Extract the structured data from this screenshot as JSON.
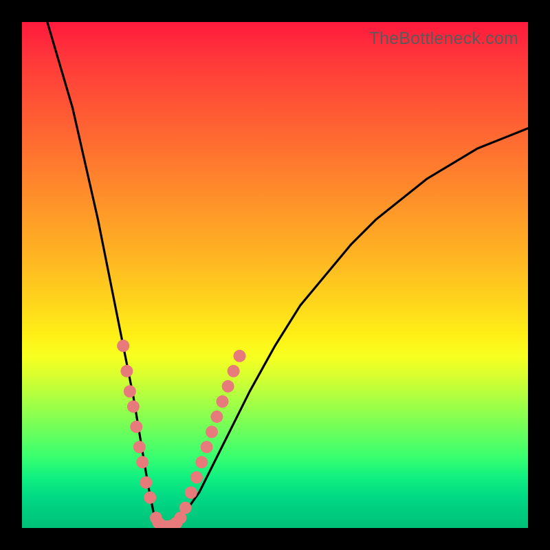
{
  "watermark": "TheBottleneck.com",
  "chart_data": {
    "type": "line",
    "title": "",
    "xlabel": "",
    "ylabel": "",
    "xlim": [
      0,
      100
    ],
    "ylim": [
      0,
      100
    ],
    "series": [
      {
        "name": "valley-curve",
        "x": [
          5,
          10,
          15,
          18,
          20,
          22,
          24,
          25,
          26,
          27,
          28,
          30,
          35,
          40,
          45,
          50,
          55,
          60,
          65,
          70,
          75,
          80,
          85,
          90,
          95,
          100
        ],
        "values": [
          100,
          83,
          61,
          46,
          36,
          26,
          14,
          8,
          3,
          1,
          0,
          0,
          7,
          17,
          27,
          36,
          44,
          50,
          56,
          61,
          65,
          69,
          72,
          75,
          77,
          79
        ]
      }
    ],
    "dot_markers": {
      "name": "highlighted-points",
      "color": "#e77a7a",
      "points": [
        {
          "x": 20.0,
          "y": 36
        },
        {
          "x": 20.7,
          "y": 31
        },
        {
          "x": 21.3,
          "y": 27
        },
        {
          "x": 22.0,
          "y": 24
        },
        {
          "x": 22.6,
          "y": 20
        },
        {
          "x": 23.2,
          "y": 16
        },
        {
          "x": 23.8,
          "y": 13
        },
        {
          "x": 24.5,
          "y": 9
        },
        {
          "x": 25.3,
          "y": 6
        },
        {
          "x": 26.5,
          "y": 2
        },
        {
          "x": 27.0,
          "y": 1
        },
        {
          "x": 27.5,
          "y": 0.5
        },
        {
          "x": 28.2,
          "y": 0.3
        },
        {
          "x": 29.0,
          "y": 0.3
        },
        {
          "x": 29.8,
          "y": 0.5
        },
        {
          "x": 30.5,
          "y": 1
        },
        {
          "x": 31.3,
          "y": 2
        },
        {
          "x": 32.3,
          "y": 4
        },
        {
          "x": 33.4,
          "y": 7
        },
        {
          "x": 34.5,
          "y": 10
        },
        {
          "x": 35.5,
          "y": 13
        },
        {
          "x": 36.5,
          "y": 16
        },
        {
          "x": 37.5,
          "y": 19
        },
        {
          "x": 38.5,
          "y": 22
        },
        {
          "x": 39.6,
          "y": 25
        },
        {
          "x": 40.7,
          "y": 28
        },
        {
          "x": 41.8,
          "y": 31
        },
        {
          "x": 43.0,
          "y": 34
        }
      ]
    }
  }
}
